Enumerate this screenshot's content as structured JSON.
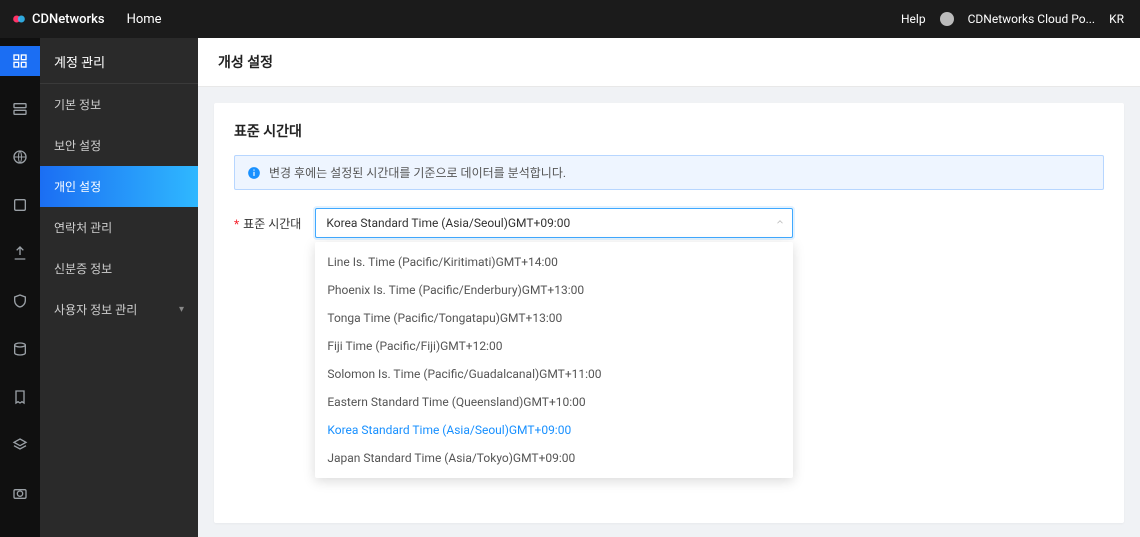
{
  "header": {
    "brand": "CDNetworks",
    "home": "Home",
    "help": "Help",
    "account": "CDNetworks Cloud Po...",
    "lang": "KR"
  },
  "sidebar": {
    "section_title": "계정 관리",
    "items": [
      {
        "label": "기본 정보"
      },
      {
        "label": "보안 설정"
      },
      {
        "label": "개인 설정"
      },
      {
        "label": "연락처 관리"
      },
      {
        "label": "신분증 정보"
      },
      {
        "label": "사용자 정보 관리"
      }
    ]
  },
  "page": {
    "title": "개성 설정",
    "card_title": "표준 시간대",
    "info": "변경 후에는 설정된 시간대를 기준으로 데이터를 분석합니다."
  },
  "form": {
    "tz_label": "표준 시간대",
    "tz_value": "Korea Standard Time (Asia/Seoul)GMT+09:00",
    "options": [
      "Line Is. Time (Pacific/Kiritimati)GMT+14:00",
      "Phoenix Is. Time (Pacific/Enderbury)GMT+13:00",
      "Tonga Time (Pacific/Tongatapu)GMT+13:00",
      "Fiji Time (Pacific/Fiji)GMT+12:00",
      "Solomon Is. Time (Pacific/Guadalcanal)GMT+11:00",
      "Eastern Standard Time (Queensland)GMT+10:00",
      "Korea Standard Time (Asia/Seoul)GMT+09:00",
      "Japan Standard Time (Asia/Tokyo)GMT+09:00"
    ],
    "selected_index": 6
  }
}
